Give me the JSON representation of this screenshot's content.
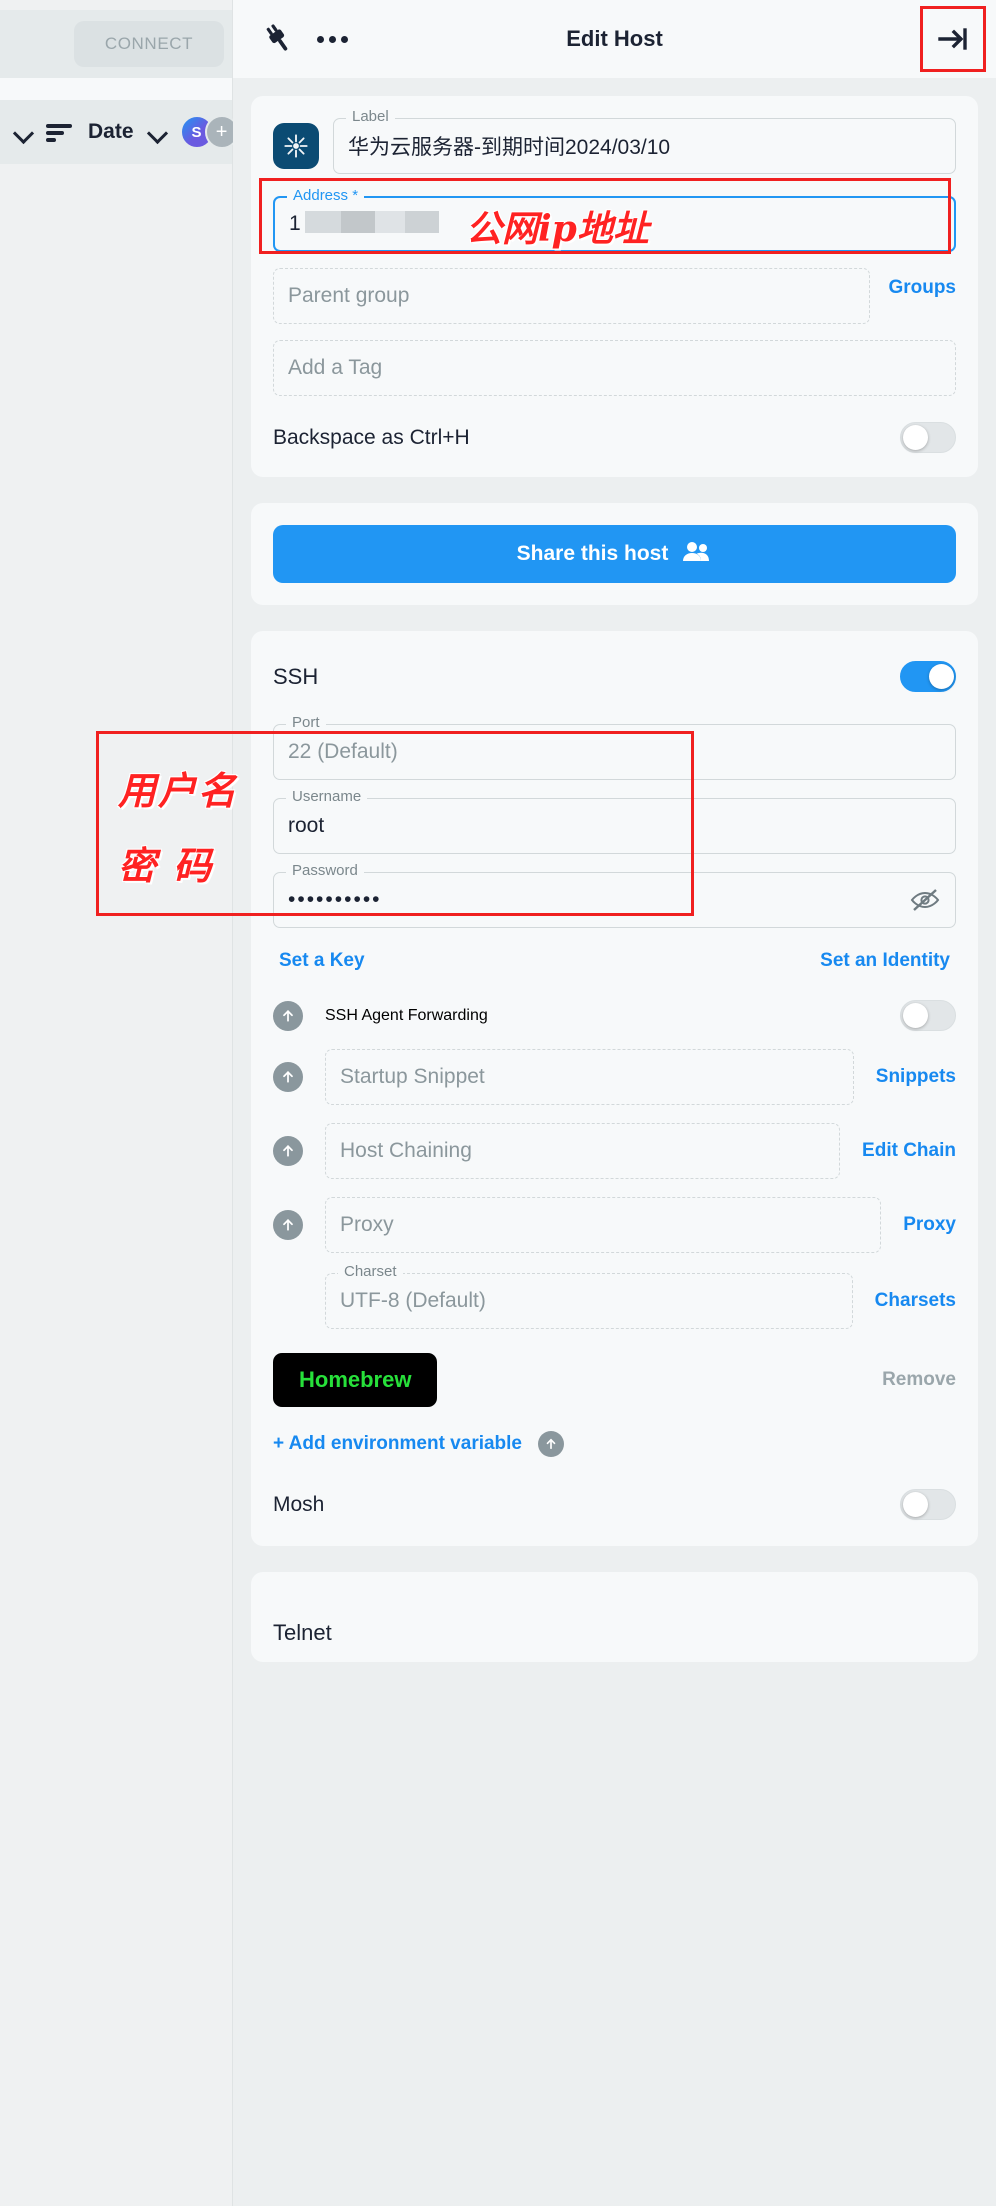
{
  "sidebar": {
    "connect_label": "CONNECT",
    "sort_label": "Date",
    "avatar_initial": "S",
    "avatar_add": "+"
  },
  "topbar": {
    "title": "Edit Host",
    "plug_icon": "plug-icon",
    "more_icon": "more-dots-icon",
    "close_icon": "exit-arrow-icon"
  },
  "host": {
    "label_field": {
      "label": "Label",
      "value": "华为云服务器-到期时间2024/03/10"
    },
    "address_field": {
      "label": "Address *",
      "value": "1"
    },
    "parent_group": {
      "placeholder": "Parent group",
      "action": "Groups"
    },
    "tag_field": {
      "placeholder": "Add a Tag"
    },
    "backspace_row": {
      "label": "Backspace as Ctrl+H",
      "enabled": false
    }
  },
  "share": {
    "label": "Share this host",
    "icon": "people-icon"
  },
  "ssh": {
    "section_label": "SSH",
    "enabled": true,
    "port": {
      "label": "Port",
      "value": "22 (Default)"
    },
    "username": {
      "label": "Username",
      "value": "root"
    },
    "password": {
      "label": "Password",
      "value": "••••••••••",
      "toggle_icon": "eye-off-icon"
    },
    "set_key": "Set a Key",
    "set_identity": "Set an Identity",
    "agent_forwarding": {
      "label": "SSH Agent Forwarding",
      "enabled": false
    },
    "startup_snippet": {
      "placeholder": "Startup Snippet",
      "action": "Snippets"
    },
    "host_chaining": {
      "placeholder": "Host Chaining",
      "action": "Edit Chain"
    },
    "proxy": {
      "placeholder": "Proxy",
      "action": "Proxy"
    },
    "charset": {
      "label": "Charset",
      "value": "UTF-8 (Default)",
      "action": "Charsets"
    },
    "env_var": {
      "name": "Homebrew",
      "remove": "Remove",
      "add": "+ Add environment variable"
    }
  },
  "mosh": {
    "label": "Mosh",
    "enabled": false
  },
  "telnet": {
    "label": "Telnet"
  },
  "annotations": {
    "address_note": "公网ip地址",
    "username_note": "用户名",
    "password_note": "密 码"
  },
  "colors": {
    "accent_blue": "#2196f3",
    "link_blue": "#1789f0",
    "annotation_red": "#f02020",
    "env_green": "#27e03a",
    "icon_navy": "#0b4b73"
  }
}
